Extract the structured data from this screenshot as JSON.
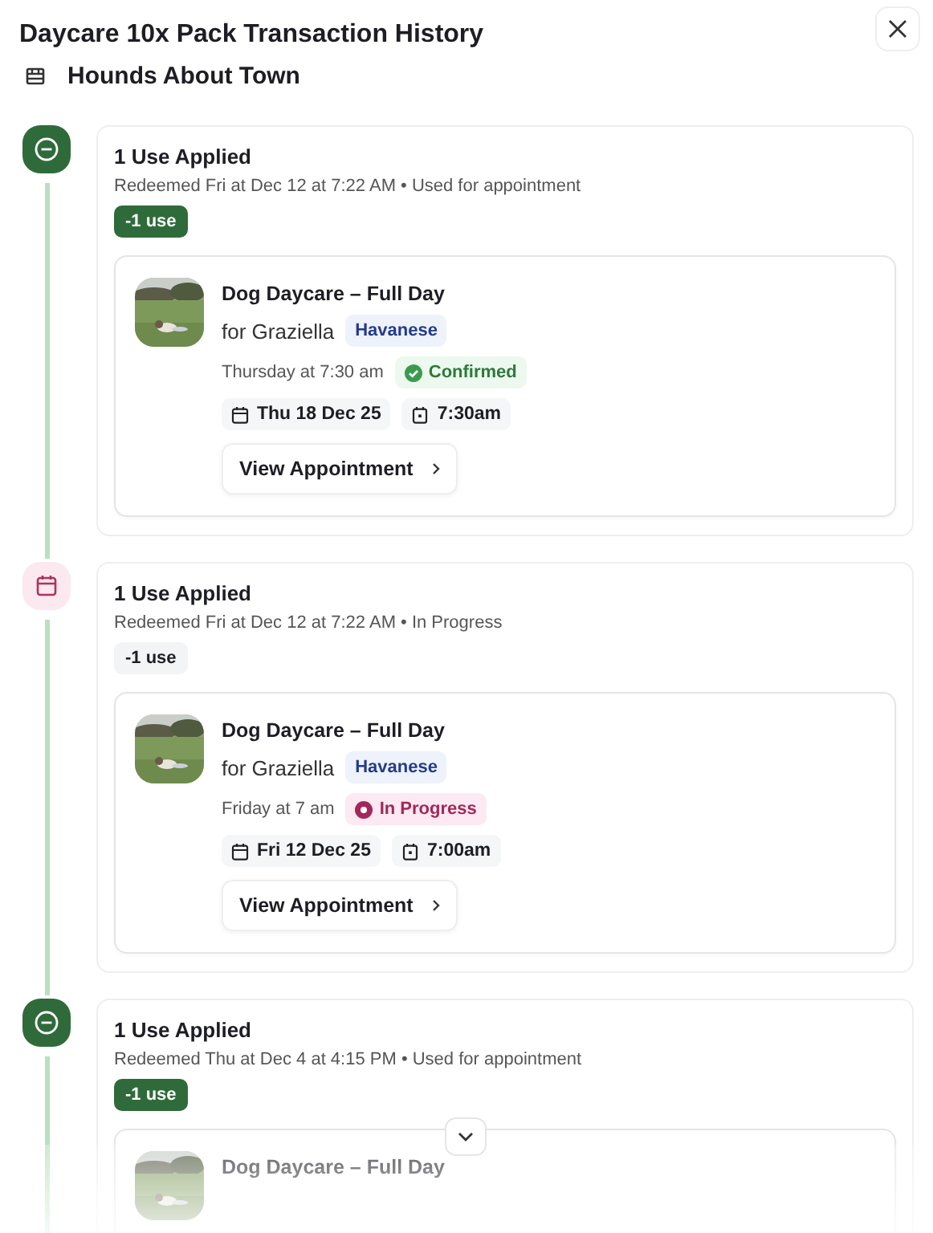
{
  "window": {
    "title": "Daycare 10x Pack Transaction History"
  },
  "business": {
    "name": "Hounds About Town"
  },
  "entries": [
    {
      "kind": "used",
      "title": "1 Use Applied",
      "subtitle": "Redeemed Fri at Dec 12 at 7:22 AM • Used for appointment",
      "badge": "-1 use",
      "appointment": {
        "title": "Dog Daycare – Full Day",
        "pet": "for Graziella",
        "breed": "Havanese",
        "when": "Thursday at 7:30 am",
        "status": {
          "kind": "confirmed",
          "label": "Confirmed"
        },
        "date": "Thu 18 Dec 25",
        "time": "7:30am",
        "button": "View Appointment"
      }
    },
    {
      "kind": "in_progress",
      "title": "1 Use Applied",
      "subtitle": "Redeemed Fri at Dec 12 at 7:22 AM • In Progress",
      "badge": "-1 use",
      "appointment": {
        "title": "Dog Daycare – Full Day",
        "pet": "for Graziella",
        "breed": "Havanese",
        "when": "Friday at 7 am",
        "status": {
          "kind": "in_progress",
          "label": "In Progress"
        },
        "date": "Fri 12 Dec 25",
        "time": "7:00am",
        "button": "View Appointment"
      }
    },
    {
      "kind": "used",
      "title": "1 Use Applied",
      "subtitle": "Redeemed Thu at Dec 4 at 4:15 PM • Used for appointment",
      "badge": "-1 use",
      "appointment": {
        "title": "Dog Daycare – Full Day"
      }
    }
  ]
}
